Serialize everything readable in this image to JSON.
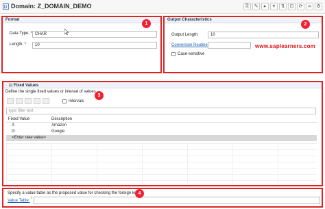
{
  "title": {
    "text": "Domain: Z_DOMAIN_DEMO"
  },
  "toolbar": {
    "icons": [
      "copy-icon",
      "edit-icon",
      "run-icon",
      "dropdown-icon",
      "sort-icon",
      "lock-icon",
      "sync-icon",
      "link-icon",
      "gear-icon"
    ]
  },
  "format": {
    "header": "Format",
    "badge": "1",
    "data_type_label": "Data Type: *",
    "data_type_value": "CHAR",
    "length_label": "Length: *",
    "length_value": "10"
  },
  "output": {
    "header": "Output Characteristics",
    "badge": "2",
    "output_length_label": "Output Length:",
    "output_length_value": "10",
    "conversion_routine_label": "Conversion Routine:",
    "conversion_routine_value": "",
    "case_sensitive_label": "Case-sensitive"
  },
  "watermark": "www.saplearners.com",
  "fixed_values": {
    "header": "Fixed Values",
    "badge": "3",
    "description": "Define the single fixed values or interval of values",
    "intervals_label": "Intervals",
    "filter_placeholder": "type filter text",
    "columns": [
      "Fixed Value",
      "Description"
    ],
    "rows": [
      {
        "value": "A",
        "description": "Amazon"
      },
      {
        "value": "G",
        "description": "Google"
      }
    ],
    "new_row_label": "<Enter new value>"
  },
  "value_table": {
    "badge": "4",
    "description": "Specify a value table as the proposed value for checking the foreign key",
    "label": "Value Table:",
    "help_mark": "?",
    "value": ""
  },
  "colors": {
    "accent_red": "#dd2222",
    "link_blue": "#1a5fb4",
    "header_bg": "#eef2f7"
  }
}
